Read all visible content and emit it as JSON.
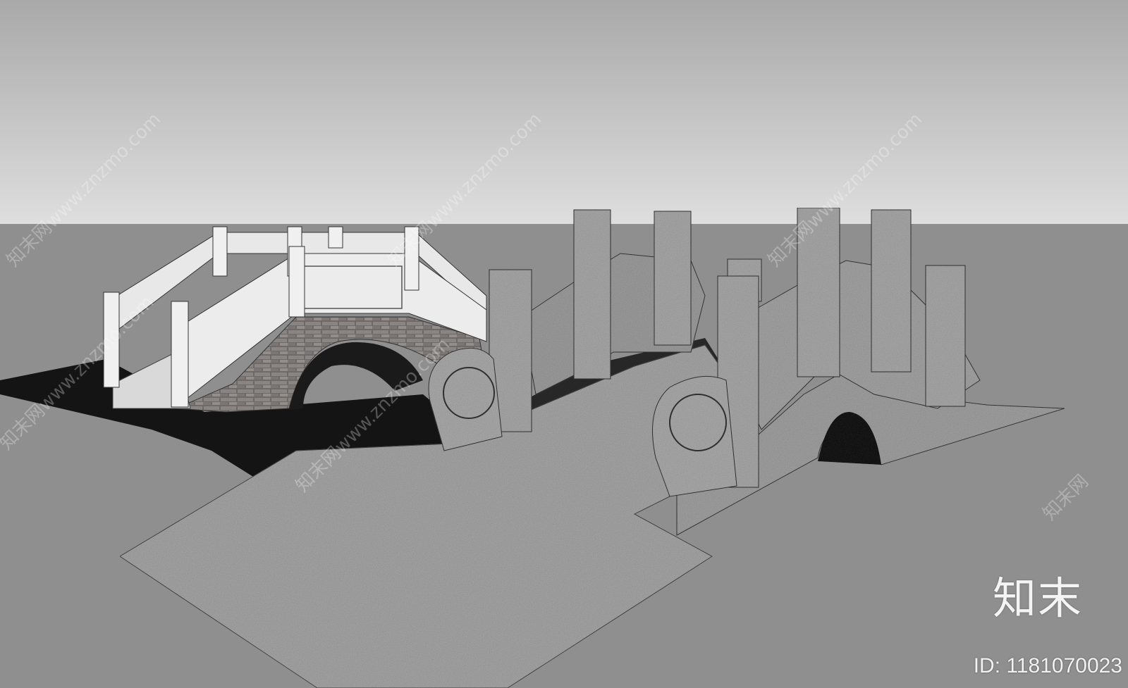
{
  "watermark": {
    "logo_text": "知末",
    "id_label": "ID: 1181070023",
    "repeat_text": "知末网www.znzmo.com"
  },
  "colors": {
    "sky_top": "#a9a9a9",
    "sky_bottom": "#dcdcdc",
    "ground": "#8f8f8f",
    "stone_light": "#e6e6e6",
    "granite": "#a3a3a3",
    "shadow": "#141414"
  }
}
